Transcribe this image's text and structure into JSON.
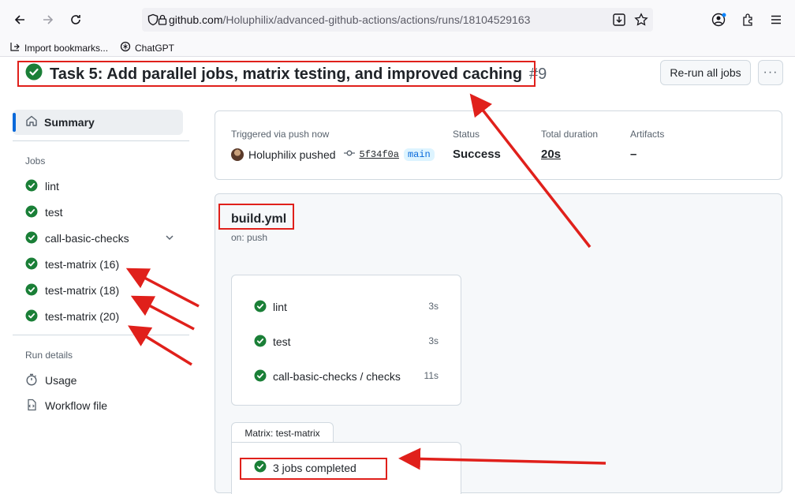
{
  "browser": {
    "url_host": "github.com",
    "url_path": "/Holuphilix/advanced-github-actions/actions/runs/18104529163",
    "bookmarks": [
      "Import bookmarks...",
      "ChatGPT"
    ]
  },
  "run": {
    "title": "Task 5: Add parallel jobs, matrix testing, and improved caching",
    "number": "#9",
    "rerun_label": "Re-run all jobs",
    "more_label": "···"
  },
  "sidebar": {
    "summary_label": "Summary",
    "jobs_heading": "Jobs",
    "jobs": [
      "lint",
      "test",
      "call-basic-checks",
      "test-matrix (16)",
      "test-matrix (18)",
      "test-matrix (20)"
    ],
    "run_details_heading": "Run details",
    "usage_label": "Usage",
    "workflow_file_label": "Workflow file"
  },
  "summary": {
    "trigger_label": "Triggered via push now",
    "actor": "Holuphilix pushed",
    "sha": "5f34f0a",
    "branch": "main",
    "status_label": "Status",
    "status_value": "Success",
    "duration_label": "Total duration",
    "duration_value": "20s",
    "artifacts_label": "Artifacts",
    "artifacts_value": "–"
  },
  "workflow": {
    "file": "build.yml",
    "trigger": "on: push",
    "jobs": [
      {
        "name": "lint",
        "time": "3s"
      },
      {
        "name": "test",
        "time": "3s"
      },
      {
        "name": "call-basic-checks / checks",
        "time": "11s"
      }
    ],
    "matrix_tab": "Matrix: test-matrix",
    "matrix_status": "3 jobs completed"
  },
  "colors": {
    "success": "#1a7f37",
    "accent": "#0969da",
    "annotation": "#e0201b"
  }
}
